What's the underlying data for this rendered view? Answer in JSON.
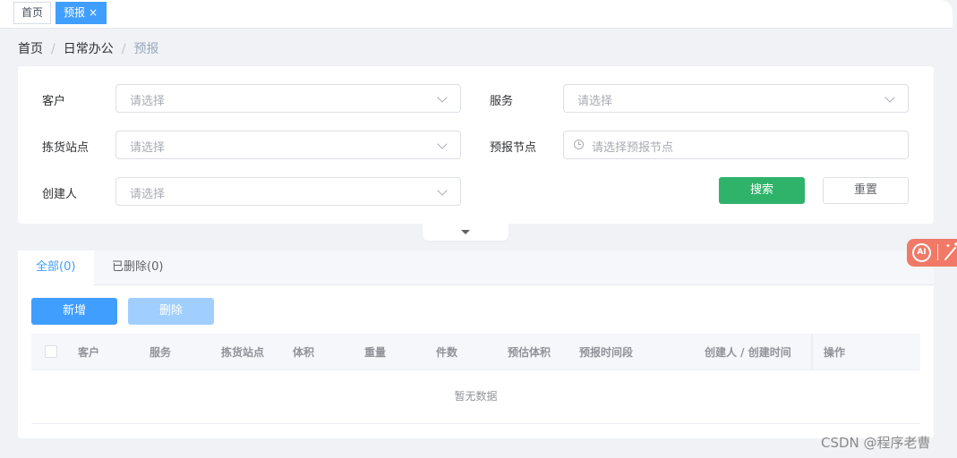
{
  "tags": {
    "home": "首页",
    "active": "预报",
    "close_glyph": "×"
  },
  "breadcrumb": {
    "items": [
      "首页",
      "日常办公",
      "预报"
    ],
    "separator": "/"
  },
  "search_form": {
    "customer_label": "客户",
    "customer_placeholder": "请选择",
    "service_label": "服务",
    "service_placeholder": "请选择",
    "pick_station_label": "拣货站点",
    "pick_station_placeholder": "请选择",
    "forecast_node_label": "预报节点",
    "forecast_node_placeholder": "请选择预报节点",
    "creator_label": "创建人",
    "creator_placeholder": "请选择",
    "search_button": "搜索",
    "reset_button": "重置"
  },
  "tabs": {
    "all": "全部(0)",
    "deleted": "已删除(0)"
  },
  "toolbar": {
    "add_button": "新增",
    "delete_button": "删除"
  },
  "table": {
    "columns": [
      "客户",
      "服务",
      "拣货站点",
      "体积",
      "重量",
      "件数",
      "预估体积",
      "预报时间段",
      "创建人 / 创建时间",
      "操作"
    ],
    "empty_text": "暂无数据"
  },
  "ai_widget": {
    "badge": "AI",
    "wand_icon": "magic-wand-icon"
  },
  "watermark": "CSDN @程序老曹",
  "colors": {
    "primary": "#409eff",
    "search_button": "#2fb36b",
    "delete_disabled": "#a0cfff",
    "ai_widget": "#f07a67"
  }
}
